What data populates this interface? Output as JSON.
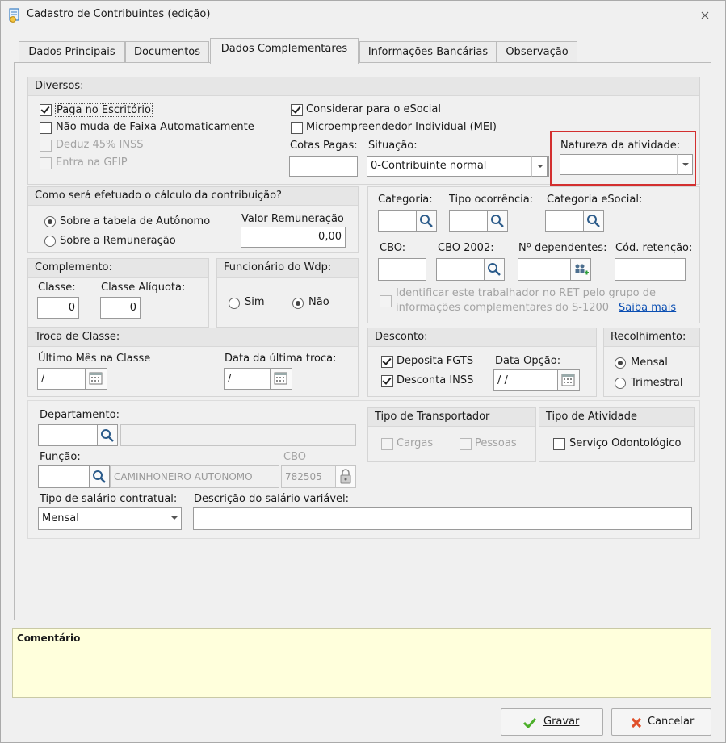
{
  "window": {
    "title": "Cadastro de Contribuintes (edição)"
  },
  "tabs": [
    "Dados Principais",
    "Documentos",
    "Dados Complementares",
    "Informações Bancárias",
    "Observação"
  ],
  "diversos": {
    "title": "Diversos:",
    "paga_escritorio": "Paga no Escritório",
    "nao_muda_faixa": "Não muda de Faixa Automaticamente",
    "deduz_inss": "Deduz 45% INSS",
    "entra_gfip": "Entra na GFIP",
    "considerar_esocial": "Considerar para o eSocial",
    "mei": "Microempreendedor Individual (MEI)",
    "cotas_pagas_label": "Cotas Pagas:",
    "cotas_pagas_value": "",
    "situacao_label": "Situação:",
    "situacao_value": "0-Contribuinte normal",
    "natureza_label": "Natureza da atividade:",
    "natureza_value": "",
    "highlight_color": "#d32f2f"
  },
  "calculo": {
    "title": "Como será efetuado o cálculo da contribuição?",
    "opt_tabela": "Sobre a tabela de Autônomo",
    "opt_remuneracao": "Sobre a Remuneração",
    "valor_label": "Valor Remuneração",
    "valor_value": "0,00"
  },
  "categoria": {
    "categoria_label": "Categoria:",
    "tipo_ocorrencia_label": "Tipo ocorrência:",
    "categoria_esocial_label": "Categoria eSocial:",
    "cbo_label": "CBO:",
    "cbo2002_label": "CBO 2002:",
    "dependentes_label": "Nº dependentes:",
    "cod_retencao_label": "Cód. retenção:",
    "ret_text_1": "Identificar este trabalhador no RET pelo grupo de",
    "ret_text_2": "informações complementares do S-1200",
    "saiba_mais": "Saiba mais"
  },
  "complemento": {
    "title": "Complemento:",
    "classe_label": "Classe:",
    "classe_value": "0",
    "aliquota_label": "Classe Alíquota:",
    "aliquota_value": "0"
  },
  "funcionario": {
    "title": "Funcionário do Wdp:",
    "sim": "Sim",
    "nao": "Não"
  },
  "troca": {
    "title": "Troca de Classe:",
    "ultimo_mes_label": "Último Mês na Classe",
    "ultimo_mes_value": "/",
    "data_troca_label": "Data da última troca:",
    "data_troca_value": "/"
  },
  "desconto": {
    "title": "Desconto:",
    "deposita_fgts": "Deposita FGTS",
    "desconta_inss": "Desconta INSS",
    "data_opcao_label": "Data Opção:",
    "data_opcao_value": "/ /"
  },
  "recolhimento": {
    "title": "Recolhimento:",
    "mensal": "Mensal",
    "trimestral": "Trimestral"
  },
  "departamento": {
    "label": "Departamento:",
    "funcao_label": "Função:",
    "funcao_value": "CAMINHONEIRO AUTONOMO",
    "cbo_label": "CBO",
    "cbo_value": "782505",
    "tipo_salario_label": "Tipo de salário contratual:",
    "tipo_salario_value": "Mensal",
    "descricao_label": "Descrição do salário variável:"
  },
  "transportador": {
    "title": "Tipo de Transportador",
    "cargas": "Cargas",
    "pessoas": "Pessoas"
  },
  "atividade": {
    "title": "Tipo de Atividade",
    "odontologico": "Serviço Odontológico"
  },
  "comentario": {
    "label": "Comentário"
  },
  "footer": {
    "gravar": "Gravar",
    "cancelar": "Cancelar"
  }
}
